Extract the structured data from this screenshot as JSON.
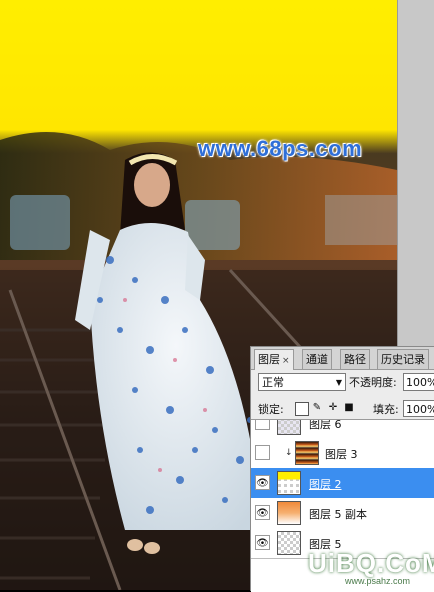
{
  "canvas": {
    "watermark_site": "www.68ps.com",
    "colors": {
      "sky": "#ffeb00",
      "shadow": "#1a1410",
      "dress": "#e8eef2",
      "flower_blue": "#3a6fc0"
    }
  },
  "panel": {
    "tabs": [
      {
        "label": "图层",
        "close": "×"
      },
      {
        "label": "通道"
      },
      {
        "label": "路径"
      },
      {
        "label": "历史记录"
      }
    ],
    "blend_mode": "正常",
    "opacity_label": "不透明度:",
    "opacity_value": "100%",
    "lock_label": "锁定:",
    "fill_label": "填充:",
    "fill_value": "100%",
    "layers": [
      {
        "name": "图层 6",
        "visible": false,
        "thumb": "checker-purple"
      },
      {
        "name": "图层 3",
        "visible": false,
        "clipped": true,
        "clip_glyph": "↓",
        "thumb": "orange-sunset"
      },
      {
        "name": "图层 2",
        "visible": true,
        "selected": true,
        "thumb": "yellow-top"
      },
      {
        "name": "图层 5 副本",
        "visible": true,
        "thumb": "orange-gradient"
      },
      {
        "name": "图层 5",
        "visible": true,
        "thumb": "checker"
      }
    ],
    "icons": {
      "eye": "eye-icon",
      "lock_transparent": "lock-transparent-icon",
      "lock_brush": "brush-icon",
      "lock_move": "move-icon",
      "lock_all": "lock-icon"
    }
  },
  "watermark": {
    "brand": "UiBQ.CoM",
    "sub": "www.psahz.com"
  }
}
